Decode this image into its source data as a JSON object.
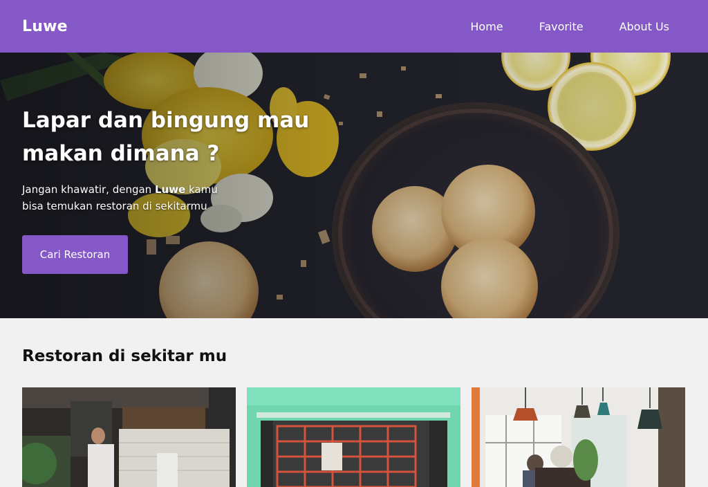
{
  "nav": {
    "brand": "Luwe",
    "links": [
      "Home",
      "Favorite",
      "About Us"
    ]
  },
  "hero": {
    "title": "Lapar dan bingung mau makan dimana ?",
    "desc_before": "Jangan khawatir, dengan ",
    "desc_brand": "Luwe",
    "desc_after": " kamu bisa temukan restoran di sekitarmu",
    "cta": "Cari Restoran"
  },
  "section": {
    "title": "Restoran di sekitar mu"
  },
  "cards": [
    {
      "image": "cafe-counter-barista-photo"
    },
    {
      "image": "green-storefront-window-photo"
    },
    {
      "image": "restaurant-interior-pendant-lamps-photo"
    }
  ],
  "colors": {
    "accent": "#8558c7",
    "background": "#f1f1f1",
    "text": "#111111"
  }
}
